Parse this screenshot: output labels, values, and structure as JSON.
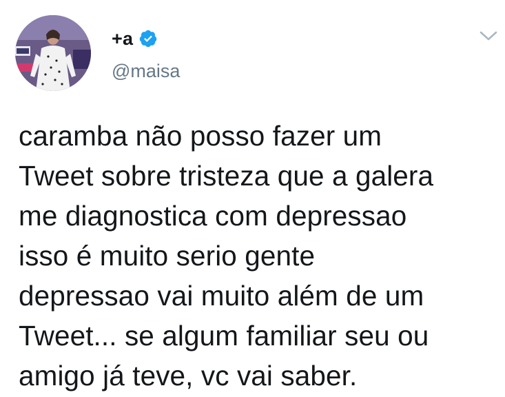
{
  "author": {
    "display_name": "+a",
    "handle": "@maisa",
    "verified": true
  },
  "tweet": {
    "text": "caramba não posso fazer um\nTweet sobre tristeza que a galera\nme diagnostica com depressao\nisso é muito serio gente\ndepressao vai muito além de um\nTweet... se algum familiar seu ou\namigo já teve, vc vai saber."
  },
  "icons": {
    "verified": "verified-badge-icon",
    "menu": "chevron-down-icon"
  },
  "colors": {
    "text": "#14171a",
    "secondary": "#657786",
    "verified_blue": "#1da1f2",
    "chevron": "#aab8c2"
  }
}
